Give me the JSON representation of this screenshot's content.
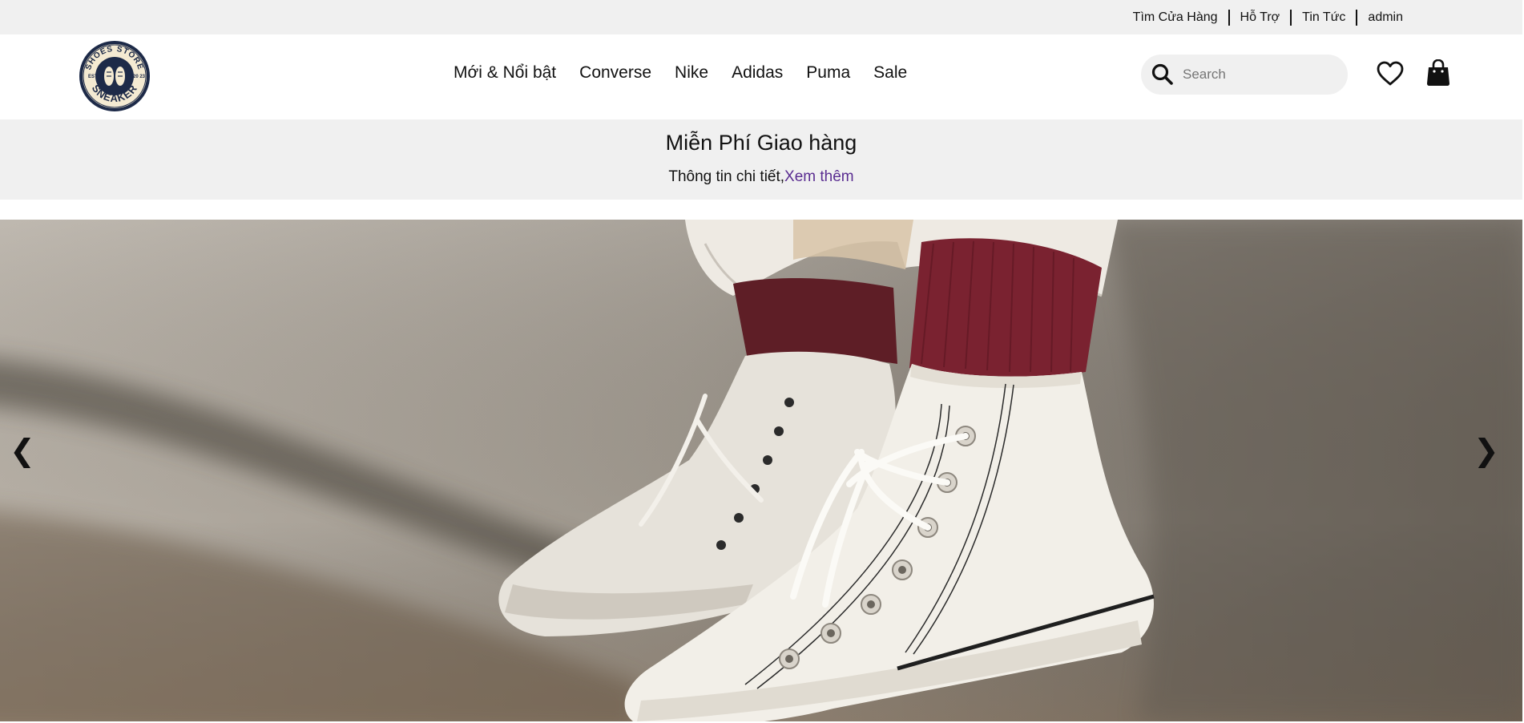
{
  "topbar": {
    "links": [
      "Tìm Cửa Hàng",
      "Hỗ Trợ",
      "Tin Tức",
      "admin"
    ]
  },
  "header": {
    "logo": {
      "name": "shoes-store-sneaker-logo",
      "top_text": "SHOES STORE",
      "bottom_text": "SNEAKER",
      "left_text": "EST TD",
      "right_text": "20 23"
    },
    "nav": [
      "Mới & Nổi bật",
      "Converse",
      "Nike",
      "Adidas",
      "Puma",
      "Sale"
    ],
    "search": {
      "placeholder": "Search",
      "icon": "search-icon"
    },
    "wishlist_icon": "heart-icon",
    "cart_icon": "shopping-bag-icon"
  },
  "promo": {
    "title": "Miễn Phí Giao hàng",
    "subtitle": "Thông tin chi tiết,",
    "link": "Xem thêm"
  },
  "hero": {
    "image": "white-high-top-sneakers-with-red-socks",
    "prev_label": "❮",
    "next_label": "❯"
  },
  "colors": {
    "bar_bg": "#f0f0f0",
    "link_purple": "#5a2d91",
    "logo_navy": "#1d2a48",
    "logo_cream": "#f4ead2"
  }
}
